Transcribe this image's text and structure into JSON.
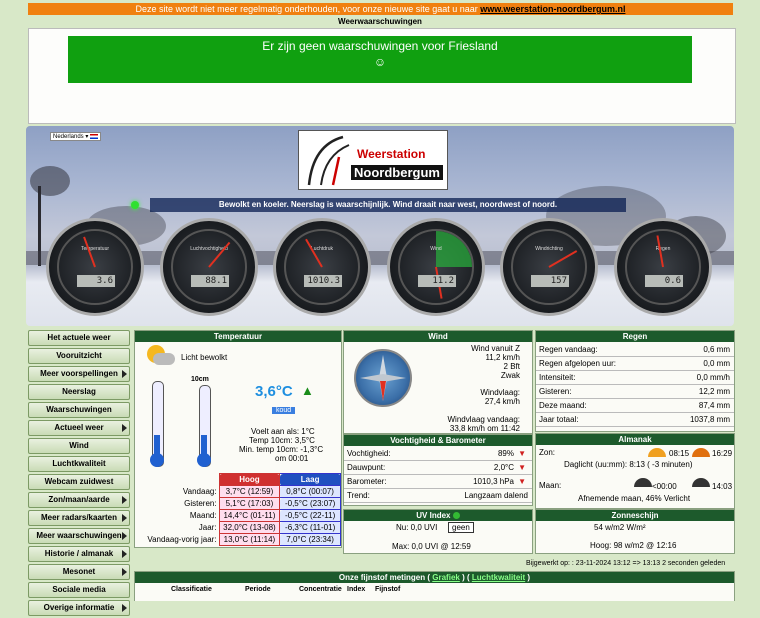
{
  "topbar": {
    "text": "Deze site wordt niet meer regelmatig onderhouden, voor onze nieuwe site gaat u naar",
    "link": "www.weerstation-noordbergum.nl"
  },
  "warnings": {
    "title": "Weerwaarschuwingen",
    "message": "Er zijn geen waarschuwingen voor Friesland",
    "smiley": "☺"
  },
  "banner": {
    "language": "Nederlands",
    "logo_line1": "Weerstation",
    "logo_line2": "Noordbergum",
    "forecast": "Bewolkt en koeler. Neerslag is waarschijnlijk. Wind draait naar west, noordwest of noord.",
    "gauges": [
      {
        "label": "Temperatuur",
        "value": "3.6"
      },
      {
        "label": "Luchtvochtigheid",
        "value": "88.1"
      },
      {
        "label": "Luchtdruk",
        "value": "1010.3"
      },
      {
        "label": "Wind",
        "value": "11.2"
      },
      {
        "label": "Windrichting",
        "value": "157"
      },
      {
        "label": "Regen",
        "value": "0.6"
      }
    ]
  },
  "menu": [
    {
      "label": "Het actuele weer",
      "sub": false
    },
    {
      "label": "Vooruitzicht",
      "sub": false
    },
    {
      "label": "Meer voorspellingen",
      "sub": true
    },
    {
      "label": "Neerslag",
      "sub": false
    },
    {
      "label": "Waarschuwingen",
      "sub": false
    },
    {
      "label": "Actueel weer",
      "sub": true
    },
    {
      "label": "Wind",
      "sub": false
    },
    {
      "label": "Luchtkwaliteit",
      "sub": false
    },
    {
      "label": "Webcam zuidwest",
      "sub": false
    },
    {
      "label": "Zon/maan/aarde",
      "sub": true
    },
    {
      "label": "Meer radars/kaarten",
      "sub": true
    },
    {
      "label": "Meer waarschuwingen",
      "sub": true
    },
    {
      "label": "Historie / almanak",
      "sub": true
    },
    {
      "label": "Mesonet",
      "sub": true
    },
    {
      "label": "Sociale media",
      "sub": false
    },
    {
      "label": "Overige informatie",
      "sub": true
    }
  ],
  "temperature": {
    "title": "Temperatuur",
    "condition": "Licht bewolkt",
    "current": "3,6°C",
    "badge": "koud",
    "soil_label": "10cm",
    "feels": "Voelt aan als: 1°C",
    "temp10": "Temp 10cm: 3,5°C",
    "min10": "Min. temp 10cm: -1,3°C",
    "min10_time": "om 00:01",
    "head_high": "Hoog",
    "head_low": "Laag",
    "rows": [
      {
        "label": "Vandaag:",
        "high": "3,7°C (12:59)",
        "low": "0,8°C (00:07)"
      },
      {
        "label": "Gisteren:",
        "high": "5,1°C (17:03)",
        "low": "-0,5°C (23:07)"
      },
      {
        "label": "Maand:",
        "high": "14,4°C (01-11)",
        "low": "-0,5°C (22-11)"
      },
      {
        "label": "Jaar:",
        "high": "32,0°C (13-08)",
        "low": "-6,3°C (11-01)"
      },
      {
        "label": "Vandaag-vorig jaar:",
        "high": "13,0°C (11:14)",
        "low": "7,0°C (23:34)"
      }
    ]
  },
  "wind": {
    "title": "Wind",
    "dir": "Wind vanuit Z",
    "speed": "11,2 km/h",
    "bft": "2 Bft",
    "desc": "Zwak",
    "gust_label": "Windvlaag:",
    "gust": "27,4 km/h",
    "gust_today_label": "Windvlaag vandaag:",
    "gust_today": "33,8 km/h om 11:42"
  },
  "humidity": {
    "title": "Vochtigheid & Barometer",
    "rows": [
      {
        "label": "Vochtigheid:",
        "value": "89%"
      },
      {
        "label": "Dauwpunt:",
        "value": "2,0°C"
      },
      {
        "label": "Barometer:",
        "value": "1010,3 hPa"
      },
      {
        "label": "Trend:",
        "value": "Langzaam dalend"
      }
    ]
  },
  "uv": {
    "title": "UV Index",
    "now": "Nu: 0,0 UVI",
    "badge": "geen",
    "max": "Max: 0,0 UVI @ 12:59"
  },
  "rain": {
    "title": "Regen",
    "rows": [
      {
        "label": "Regen vandaag:",
        "value": "0,6 mm"
      },
      {
        "label": "Regen afgelopen uur:",
        "value": "0,0 mm"
      },
      {
        "label": "Intensiteit:",
        "value": "0,0 mm/h"
      },
      {
        "label": "Gisteren:",
        "value": "12,2 mm"
      },
      {
        "label": "Deze maand:",
        "value": "87,4 mm"
      },
      {
        "label": "Jaar totaal:",
        "value": "1037,8 mm"
      }
    ]
  },
  "almanac": {
    "title": "Almanak",
    "sun_label": "Zon:",
    "sunrise": "08:15",
    "sunset": "16:29",
    "daylight": "Daglicht (uu:mm): 8:13 ( -3 minuten)",
    "moon_label": "Maan:",
    "moonrise": "<00:00",
    "moonset": "14:03",
    "moon_phase": "Afnemende maan, 46% Verlicht"
  },
  "sunshine": {
    "title": "Zonneschijn",
    "now": "54 w/m2 W/m²",
    "high": "Hoog: 98 w/m2 @ 12:16"
  },
  "updated": "Bijgewerkt op: : 23-11-2024 13:12 => 13:13 2 seconden geleden",
  "fijnstof": {
    "title": "Onze fijnstof metingen",
    "link1": "Grafiek",
    "link2": "Luchtkwaliteit",
    "columns": [
      "Classificatie",
      "Periode",
      "Concentratie",
      "Index",
      "Fijnstof"
    ]
  }
}
